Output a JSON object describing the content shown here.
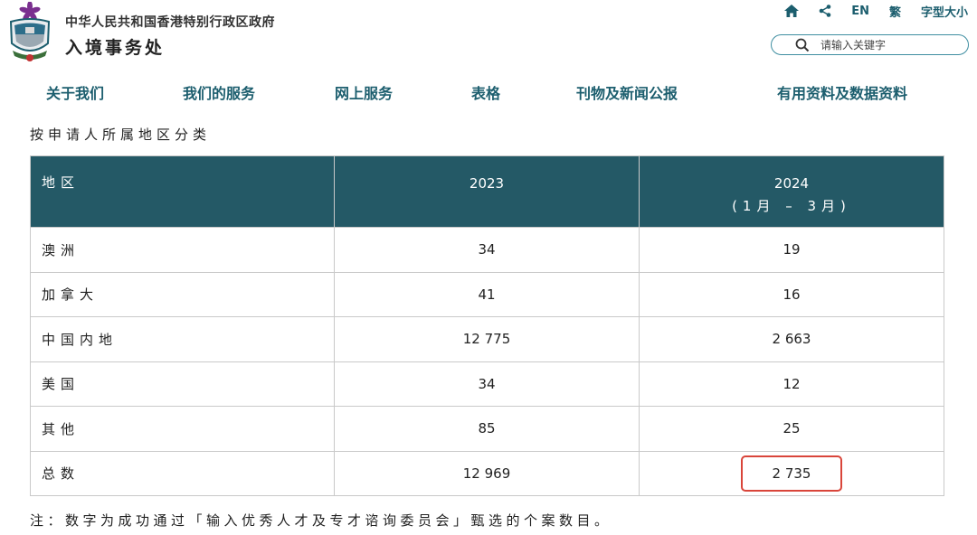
{
  "header": {
    "gov_name": "中华人民共和国香港特别行政区政府",
    "dept_name": "入境事务处"
  },
  "utility": {
    "home_icon": "home-icon",
    "share_icon": "share-icon",
    "lang_en": "EN",
    "lang_trad": "繁",
    "font_size": "字型大小"
  },
  "search": {
    "placeholder": "请输入关键字"
  },
  "nav": {
    "items": [
      "关于我们",
      "我们的服务",
      "网上服务",
      "表格",
      "刊物及新闻公报",
      "有用资料及数据资料"
    ]
  },
  "caption": "按申请人所属地区分类",
  "table": {
    "headers": {
      "region": "地区",
      "y2023": "2023",
      "y2024": "2024",
      "y2024_sub": "(1月  – 3月)"
    },
    "rows": [
      {
        "region": "澳洲",
        "v2023": "34",
        "v2024": "19"
      },
      {
        "region": "加拿大",
        "v2023": "41",
        "v2024": "16"
      },
      {
        "region": "中国内地",
        "v2023": "12 775",
        "v2024": "2 663"
      },
      {
        "region": "美国",
        "v2023": "34",
        "v2024": "12"
      },
      {
        "region": "其他",
        "v2023": "85",
        "v2024": "25"
      },
      {
        "region": "总数",
        "v2023": "12 969",
        "v2024": "2 735"
      }
    ]
  },
  "note": "注：数字为成功通过「输入优秀人才及专才谘询委员会」甄选的个案数目。",
  "colors": {
    "brand": "#245966",
    "nav_text": "#1c5e6e",
    "highlight": "#d9453a"
  }
}
